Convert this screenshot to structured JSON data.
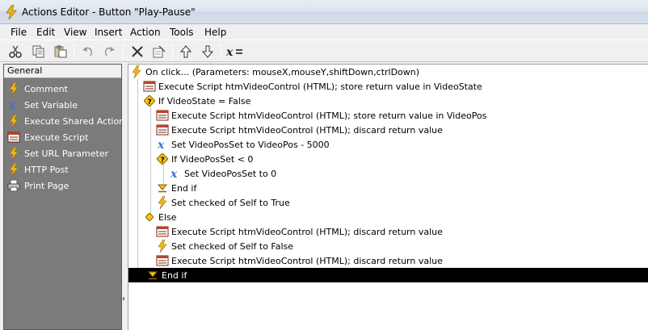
{
  "window": {
    "title": "Actions Editor - Button \"Play-Pause\""
  },
  "menu": [
    "File",
    "Edit",
    "View",
    "Insert",
    "Action",
    "Tools",
    "Help"
  ],
  "toolbar": {
    "buttons": [
      "cut",
      "copy",
      "paste",
      "undo",
      "redo",
      "delete",
      "properties",
      "move-up",
      "move-down",
      "set-variable"
    ]
  },
  "sidebar": {
    "header": "General",
    "items": [
      {
        "label": "Comment",
        "icon": "lightning-icon"
      },
      {
        "label": "Set Variable",
        "icon": "variable-x-icon"
      },
      {
        "label": "Execute Shared Actions",
        "icon": "lightning-icon"
      },
      {
        "label": "Execute Script",
        "icon": "script-icon"
      },
      {
        "label": "Set URL Parameter",
        "icon": "lightning-icon"
      },
      {
        "label": "HTTP Post",
        "icon": "lightning-icon"
      },
      {
        "label": "Print Page",
        "icon": "printer-icon"
      }
    ]
  },
  "script": {
    "rows": [
      {
        "text": "On click... (Parameters: mouseX,mouseY,shiftDown,ctrlDown)",
        "icon": "lightning"
      },
      {
        "text": "Execute Script htmVideoControl (HTML); store return value in VideoState",
        "icon": "script"
      },
      {
        "text": "If VideoState = False",
        "icon": "if"
      },
      {
        "text": "Execute Script htmVideoControl (HTML); store return value in VideoPos",
        "icon": "script"
      },
      {
        "text": "Execute Script htmVideoControl (HTML); discard return value",
        "icon": "script"
      },
      {
        "text": "Set VideoPosSet to VideoPos - 5000",
        "icon": "variable"
      },
      {
        "text": "If VideoPosSet < 0",
        "icon": "if"
      },
      {
        "text": "Set VideoPosSet to 0",
        "icon": "variable"
      },
      {
        "text": "End if",
        "icon": "endif"
      },
      {
        "text": "Set checked of Self to True",
        "icon": "lightning"
      },
      {
        "text": "Else",
        "icon": "else"
      },
      {
        "text": "Execute Script htmVideoControl (HTML); discard return value",
        "icon": "script"
      },
      {
        "text": "Set checked of Self to False",
        "icon": "lightning"
      },
      {
        "text": "Execute Script htmVideoControl (HTML); discard return value",
        "icon": "script"
      },
      {
        "text": "End if",
        "icon": "endif"
      }
    ]
  },
  "colors": {
    "sidebar_bg": "#7b7b7b",
    "selection_bg": "#000000",
    "lightning": "#f3b619"
  }
}
